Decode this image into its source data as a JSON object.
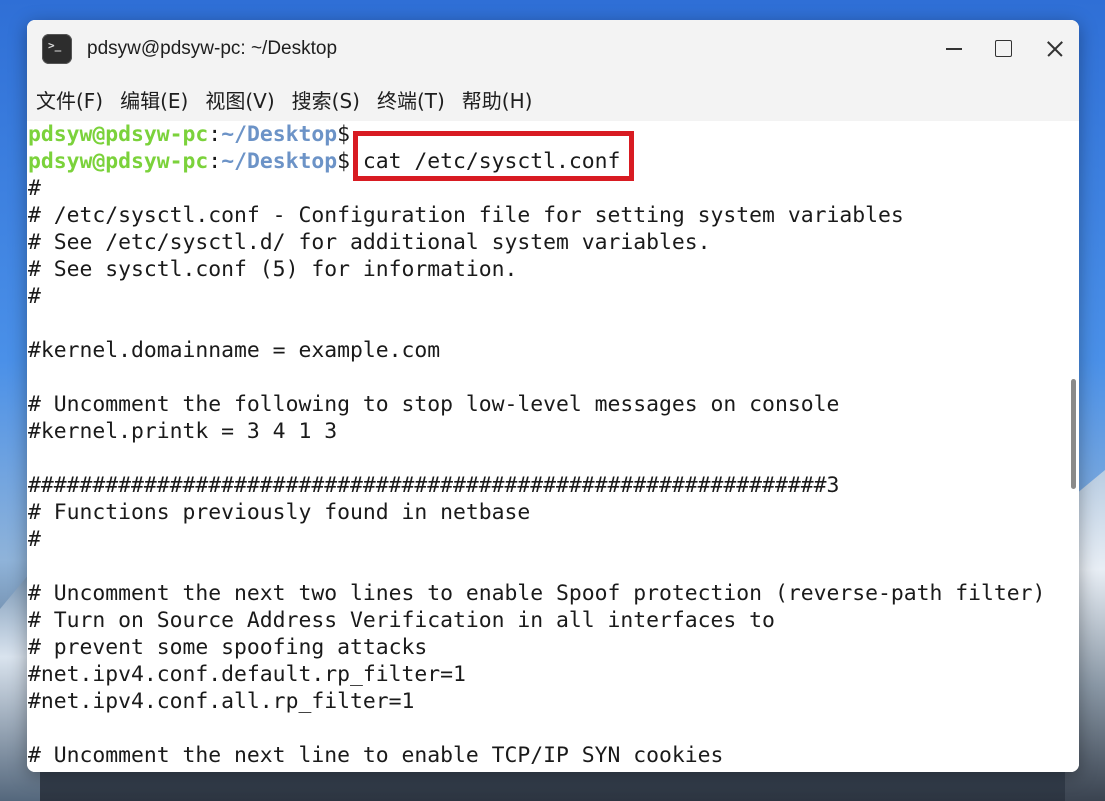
{
  "window": {
    "title": "pdsyw@pdsyw-pc: ~/Desktop"
  },
  "menu": [
    {
      "label": "文件(F)"
    },
    {
      "label": "编辑(E)"
    },
    {
      "label": "视图(V)"
    },
    {
      "label": "搜索(S)"
    },
    {
      "label": "终端(T)"
    },
    {
      "label": "帮助(H)"
    }
  ],
  "prompt": {
    "user_host": "pdsyw@pdsyw-pc",
    "colon": ":",
    "path": "~/Desktop",
    "dollar": "$",
    "command": " cat /etc/sysctl.conf"
  },
  "output": [
    "#",
    "# /etc/sysctl.conf - Configuration file for setting system variables",
    "# See /etc/sysctl.d/ for additional system variables.",
    "# See sysctl.conf (5) for information.",
    "#",
    "",
    "#kernel.domainname = example.com",
    "",
    "# Uncomment the following to stop low-level messages on console",
    "#kernel.printk = 3 4 1 3",
    "",
    "##############################################################3",
    "# Functions previously found in netbase",
    "#",
    "",
    "# Uncomment the next two lines to enable Spoof protection (reverse-path filter)",
    "# Turn on Source Address Verification in all interfaces to",
    "# prevent some spoofing attacks",
    "#net.ipv4.conf.default.rp_filter=1",
    "#net.ipv4.conf.all.rp_filter=1",
    "",
    "# Uncomment the next line to enable TCP/IP SYN cookies"
  ],
  "colors": {
    "prompt_user": "#7bd23b",
    "prompt_path": "#6c93c7",
    "highlight": "#d81b22"
  }
}
